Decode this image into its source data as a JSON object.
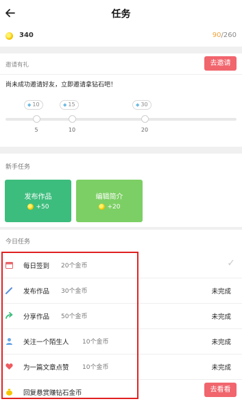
{
  "header": {
    "title": "任务"
  },
  "coins": {
    "count": "340",
    "progress_current": "90",
    "progress_total": "/260"
  },
  "invite": {
    "label": "邀请有礼",
    "button": "去邀请",
    "description": "尚未成功邀请好友，立即邀请拿钻石吧！",
    "milestones": [
      {
        "reward": "10",
        "friends": "5"
      },
      {
        "reward": "15",
        "friends": "10"
      },
      {
        "reward": "30",
        "friends": "20"
      }
    ]
  },
  "newbie": {
    "title": "新手任务",
    "cards": [
      {
        "name": "发布作品",
        "reward": "+50",
        "color": "#3dbd7d"
      },
      {
        "name": "编辑简介",
        "reward": "+20",
        "color": "#7ccf64"
      }
    ]
  },
  "daily": {
    "title": "今日任务",
    "tasks": [
      {
        "name": "每日签到",
        "reward": "20个金币",
        "status": "",
        "icon": "calendar-icon"
      },
      {
        "name": "发布作品",
        "reward": "30个金币",
        "status": "未完成",
        "icon": "pencil-icon"
      },
      {
        "name": "分享作品",
        "reward": "50个金币",
        "status": "未完成",
        "icon": "share-arrow-icon"
      },
      {
        "name": "关注一个陌生人",
        "reward": "10个金币",
        "status": "未完成",
        "icon": "person-icon"
      },
      {
        "name": "为一篇文章点赞",
        "reward": "10个金币",
        "status": "未完成",
        "icon": "heart-icon"
      },
      {
        "name": "回复悬赏赚钻石金币",
        "reward": "",
        "status": "",
        "button": "去看看",
        "icon": "money-bag-icon"
      }
    ]
  },
  "colors": {
    "accent": "#f1656d",
    "progress_highlight": "#f0a33a",
    "annotation": "#e02020"
  }
}
